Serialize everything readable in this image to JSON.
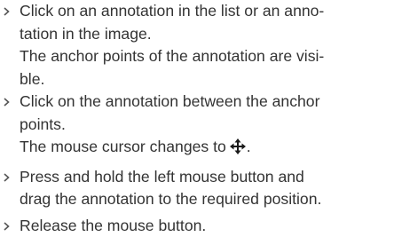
{
  "instructions": [
    {
      "step": [
        "Click on an annotation in the list or an anno-",
        "tation in the image."
      ],
      "result": [
        "The anchor points of the annotation are visi-",
        "ble."
      ]
    },
    {
      "step": [
        "Click on the annotation between the anchor",
        "points."
      ],
      "result_prefix": "The mouse cursor changes to",
      "result_icon": "move-cursor-icon",
      "result_suffix": "."
    },
    {
      "step": [
        "Press and hold the left mouse button and",
        "drag the annotation to the required position."
      ]
    },
    {
      "step": [
        "Release the mouse button."
      ]
    }
  ],
  "colors": {
    "text": "#333333",
    "bullet": "#555555",
    "icon": "#1a1a1a"
  }
}
